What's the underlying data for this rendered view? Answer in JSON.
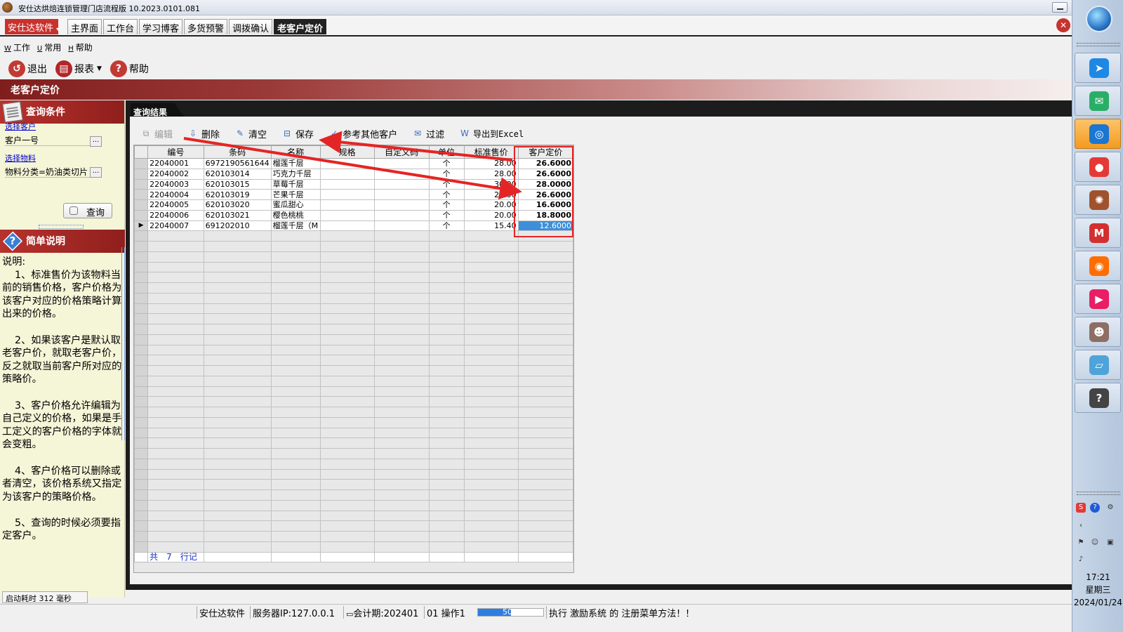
{
  "window": {
    "title": "安仕达烘焙连锁管理门店流程版  10.2023.0101.081"
  },
  "brand_button": "安仕达软件",
  "tabs": [
    {
      "label": "主界面"
    },
    {
      "label": "工作台"
    },
    {
      "label": "学习博客"
    },
    {
      "label": "多货预警"
    },
    {
      "label": "调拨确认"
    },
    {
      "label": "老客户定价"
    }
  ],
  "menu": [
    {
      "key": "W",
      "label": "工作"
    },
    {
      "key": "U",
      "label": "常用"
    },
    {
      "key": "H",
      "label": "帮助"
    }
  ],
  "toolbar": {
    "exit": "退出",
    "report": "报表",
    "help": "帮助"
  },
  "page_title": "老客户定价",
  "query_panel": {
    "title": "查询条件",
    "select_customer_label": "选择客户",
    "customer_value": "客户一号",
    "select_material_label": "选择物料",
    "material_value": "物料分类=奶油类切片",
    "dots": "...",
    "query_button": "查询"
  },
  "help_panel": {
    "title": "简单说明",
    "intro": "说明:",
    "paragraphs": [
      "    1、标准售价为该物料当前的销售价格，客户价格为该客户对应的价格策略计算出来的价格。",
      "    2、如果该客户是默认取老客户价，就取老客户价，反之就取当前客户所对应的策略价。",
      "    3、客户价格允许编辑为自己定义的价格，如果是手工定义的客户价格的字体就会变粗。",
      "    4、客户价格可以删除或者清空，该价格系统又指定为该客户的策略价格。",
      "    5、查询的时候必须要指定客户。"
    ]
  },
  "startup": "启动耗时 312 毫秒",
  "results": {
    "tab_label": "查询结果",
    "grid_toolbar": {
      "edit": "编辑",
      "delete": "删除",
      "clear": "清空",
      "save": "保存",
      "ref_other": "参考其他客户",
      "filter": "过滤",
      "export": "导出到Excel"
    },
    "columns": [
      "编号",
      "条码",
      "名称",
      "规格",
      "自定义码",
      "单位",
      "标准售价",
      "客户定价"
    ],
    "rows": [
      {
        "code": "22040001",
        "barcode": "6972190561644",
        "name": "榴莲千层",
        "spec": "",
        "custom": "",
        "unit": "个",
        "std": "28.00",
        "price": "26.6000",
        "bold": true
      },
      {
        "code": "22040002",
        "barcode": "620103014",
        "name": "巧克力千层",
        "spec": "",
        "custom": "",
        "unit": "个",
        "std": "28.00",
        "price": "26.6000",
        "bold": true
      },
      {
        "code": "22040003",
        "barcode": "620103015",
        "name": "草莓千层",
        "spec": "",
        "custom": "",
        "unit": "个",
        "std": "30.00",
        "price": "28.0000",
        "bold": true
      },
      {
        "code": "22040004",
        "barcode": "620103019",
        "name": "芒果千层",
        "spec": "",
        "custom": "",
        "unit": "个",
        "std": "28.00",
        "price": "26.6000",
        "bold": true
      },
      {
        "code": "22040005",
        "barcode": "620103020",
        "name": "蜜瓜甜心",
        "spec": "",
        "custom": "",
        "unit": "个",
        "std": "20.00",
        "price": "16.6000",
        "bold": true
      },
      {
        "code": "22040006",
        "barcode": "620103021",
        "name": "樱色桃桃",
        "spec": "",
        "custom": "",
        "unit": "个",
        "std": "20.00",
        "price": "18.8000",
        "bold": true
      },
      {
        "code": "22040007",
        "barcode": "691202010",
        "name": "榴莲千层（M",
        "spec": "",
        "custom": "",
        "unit": "个",
        "std": "15.40",
        "price": "12.6000",
        "bold": false,
        "selected": true
      }
    ],
    "footer": {
      "prefix": "共",
      "count": "7",
      "suffix": "行记"
    }
  },
  "statusbar": {
    "company": "安仕达软件",
    "server": "服务器IP:127.0.0.1",
    "period": "会计期:202401",
    "operator": "01 操作1",
    "progress_text": "50%",
    "progress": 0.5,
    "message": "执行 激励系统 的 注册菜单方法！！"
  },
  "taskbar": {
    "apps": [
      {
        "icon": "feishu-icon",
        "color": "#1e88e5"
      },
      {
        "icon": "wechat-icon",
        "color": "#2aae67"
      },
      {
        "icon": "search-globe-icon",
        "color": "#1976d2"
      },
      {
        "icon": "apple-icon",
        "color": "#e53935"
      },
      {
        "icon": "bread-icon",
        "color": "#a0522d"
      },
      {
        "icon": "m-app-icon",
        "color": "#d32f2f"
      },
      {
        "icon": "firefox-icon",
        "color": "#ff6d00"
      },
      {
        "icon": "video-app-icon",
        "color": "#e91e63"
      },
      {
        "icon": "avatar-app-icon",
        "color": "#8d6e63"
      },
      {
        "icon": "notebook-icon",
        "color": "#4fa3d8"
      },
      {
        "icon": "help-doc-icon",
        "color": "#444444"
      }
    ],
    "time": "17:21",
    "weekday": "星期三",
    "date": "2024/01/24"
  }
}
